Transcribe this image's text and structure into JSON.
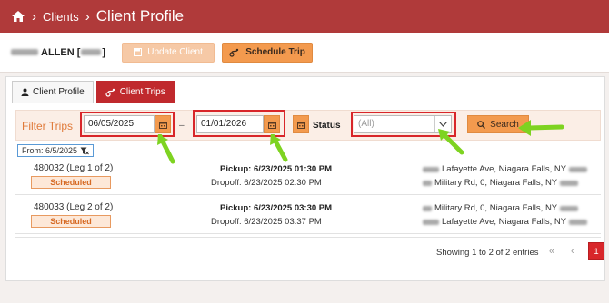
{
  "breadcrumb": {
    "section": "Clients",
    "title": "Client Profile"
  },
  "client": {
    "name_suffix": "ALLEN [",
    "name_close": "]"
  },
  "toolbar": {
    "update_label": "Update Client",
    "schedule_label": "Schedule Trip"
  },
  "tabs": [
    {
      "label": "Client Profile"
    },
    {
      "label": "Client Trips"
    }
  ],
  "filter": {
    "label": "Filter Trips",
    "start_date": "06/05/2025",
    "dash": "–",
    "end_date": "01/01/2026",
    "status_label": "Status",
    "status_value": "(All)",
    "search_label": "Search",
    "chip": "From: 6/5/2025"
  },
  "trips": [
    {
      "id": "480032 (Leg 1 of 2)",
      "status": "Scheduled",
      "pickup": "Pickup: 6/23/2025 01:30 PM",
      "dropoff": "Dropoff: 6/23/2025 02:30 PM",
      "from_addr": "Lafayette Ave, Niagara Falls, NY",
      "to_addr": "Military Rd, 0, Niagara Falls, NY"
    },
    {
      "id": "480033 (Leg 2 of 2)",
      "status": "Scheduled",
      "pickup": "Pickup: 6/23/2025 03:30 PM",
      "dropoff": "Dropoff: 6/23/2025 03:37 PM",
      "from_addr": "Military Rd, 0, Niagara Falls, NY",
      "to_addr": "Lafayette Ave, Niagara Falls, NY"
    }
  ],
  "pagination": {
    "info": "Showing 1 to 2 of 2 entries",
    "first": "«",
    "prev": "‹",
    "current": "1"
  },
  "colors": {
    "header": "#b03a3a",
    "accent": "#f39a4e",
    "highlight": "#d8262a",
    "annotation_arrow": "#7ed321"
  }
}
